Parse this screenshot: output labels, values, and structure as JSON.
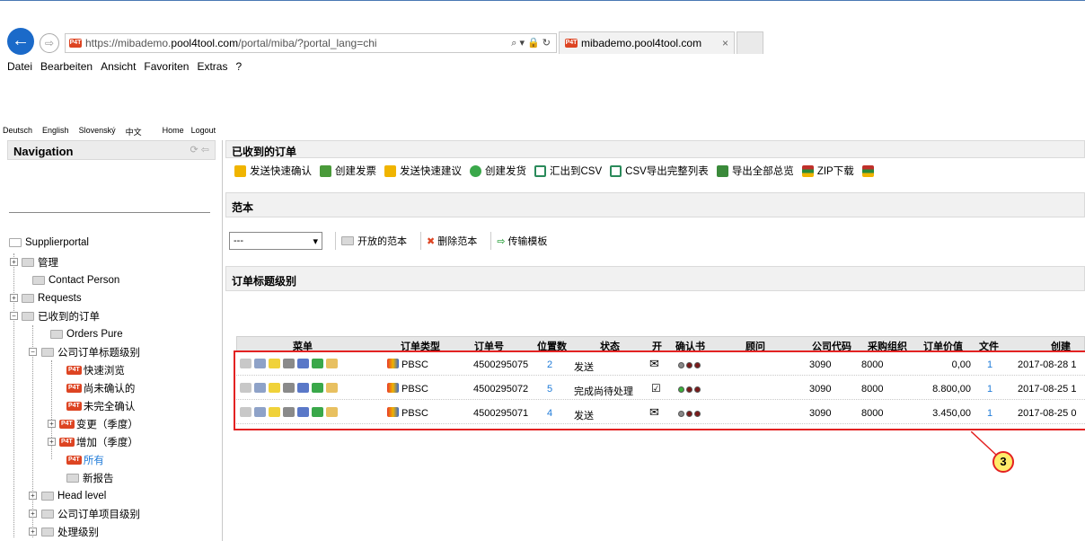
{
  "browser": {
    "url_prefix": "https://mibademo.",
    "url_domain": "pool4tool.com",
    "url_suffix": "/portal/miba/?portal_lang=chi",
    "addr_icons": "⌕ ▾ 🔒 ↻",
    "tab_title": "mibademo.pool4tool.com",
    "tab_close": "×",
    "back_glyph": "←",
    "forward_glyph": "⇨",
    "favicon_text": "P4T",
    "menu": [
      "Datei",
      "Bearbeiten",
      "Ansicht",
      "Favoriten",
      "Extras",
      "?"
    ]
  },
  "languages": [
    "Deutsch",
    "English",
    "Slovenský",
    "中文"
  ],
  "top_links": {
    "home": "Home",
    "logout": "Logout"
  },
  "sidebar": {
    "title": "Navigation",
    "title_icons": "⟳ ⇦",
    "root": "Supplierportal",
    "badge": "P4T",
    "items": [
      {
        "label": "管理"
      },
      {
        "label": "Contact Person"
      },
      {
        "label": "Requests"
      },
      {
        "label": "已收到的订单"
      },
      {
        "label": "Orders Pure"
      },
      {
        "label": "公司订单标题级别"
      },
      {
        "label": "快速浏览"
      },
      {
        "label": "尚未确认的"
      },
      {
        "label": "未完全确认"
      },
      {
        "label": "变更（季度）"
      },
      {
        "label": "增加（季度）"
      },
      {
        "label": "所有"
      },
      {
        "label": "新报告"
      },
      {
        "label": "Head level"
      },
      {
        "label": "公司订单项目级别"
      },
      {
        "label": "处理级别"
      }
    ]
  },
  "main": {
    "title": "已收到的订单",
    "toolbar": [
      {
        "label": "发送快速确认",
        "icon": "send-confirm-icon",
        "color": "#f0b400"
      },
      {
        "label": "创建发票",
        "icon": "invoice-icon",
        "color": "#4a9a3a"
      },
      {
        "label": "发送快速建议",
        "icon": "send-suggest-icon",
        "color": "#f0b400"
      },
      {
        "label": "创建发货",
        "icon": "shipment-icon",
        "color": "#3aa84a"
      },
      {
        "label": "汇出到CSV",
        "icon": "csv-icon",
        "color": "#2a8a5a"
      },
      {
        "label": "CSV导出完整列表",
        "icon": "csv-full-icon",
        "color": "#2a8a5a"
      },
      {
        "label": "导出全部总览",
        "icon": "excel-icon",
        "color": "#3a8a3a"
      },
      {
        "label": "ZIP下载",
        "icon": "zip-icon",
        "color": "#c0302a"
      },
      {
        "label": "",
        "icon": "archive-icon",
        "color": "#c0302a"
      }
    ],
    "template_section": {
      "title": "范本",
      "select_value": "---",
      "open_label": "开放的范本",
      "delete_label": "删除范本",
      "transfer_label": "传输模板"
    },
    "order_section": {
      "title": "订单标题级别"
    },
    "table": {
      "headers": {
        "menu": "菜单",
        "type": "订单类型",
        "order_no": "订单号",
        "positions": "位置数",
        "status": "状态",
        "open": "开",
        "confirmation": "确认书",
        "advisor": "顾问",
        "company_code": "公司代码",
        "purch_org": "采购组织",
        "order_value": "订单价值",
        "files": "文件",
        "created": "创建"
      },
      "rows": [
        {
          "type": "PBSC",
          "order_no": "4500295075",
          "positions": "2",
          "status": "发送",
          "open": "✉",
          "company_code": "3090",
          "purch_org": "8000",
          "order_value": "0,00",
          "files": "1",
          "created": "2017-08-28 1",
          "lights": [
            "#888888",
            "#7a1a1a",
            "#7a1a1a"
          ]
        },
        {
          "type": "PBSC",
          "order_no": "4500295072",
          "positions": "5",
          "status": "完成尚待处理",
          "open": "☑",
          "company_code": "3090",
          "purch_org": "8000",
          "order_value": "8.800,00",
          "files": "1",
          "created": "2017-08-25 1",
          "lights": [
            "#3ab03a",
            "#7a1a1a",
            "#7a1a1a"
          ]
        },
        {
          "type": "PBSC",
          "order_no": "4500295071",
          "positions": "4",
          "status": "发送",
          "open": "✉",
          "company_code": "3090",
          "purch_org": "8000",
          "order_value": "3.450,00",
          "files": "1",
          "created": "2017-08-25 0",
          "lights": [
            "#888888",
            "#7a1a1a",
            "#7a1a1a"
          ]
        }
      ]
    },
    "callout": "3"
  }
}
